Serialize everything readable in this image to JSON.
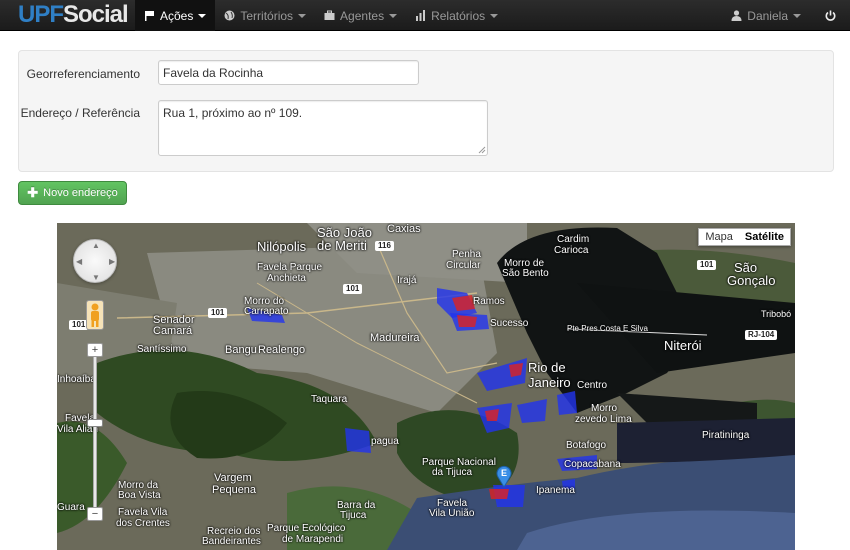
{
  "brand": {
    "part1": "UPF",
    "part2": "Social"
  },
  "nav": {
    "items": [
      {
        "label": "Ações",
        "icon": "flag-icon",
        "active": true
      },
      {
        "label": "Territórios",
        "icon": "globe-icon",
        "active": false
      },
      {
        "label": "Agentes",
        "icon": "briefcase-icon",
        "active": false
      },
      {
        "label": "Relatórios",
        "icon": "bar-chart-icon",
        "active": false
      }
    ],
    "user": "Daniela",
    "power_icon": "power-icon"
  },
  "form": {
    "georef_label": "Georreferenciamento",
    "georef_value": "Favela da Rocinha",
    "address_label": "Endereço / Referência",
    "address_value": "Rua 1, próximo ao nº 109."
  },
  "new_address_button": "Novo endereço",
  "map": {
    "type_map": "Mapa",
    "type_satellite": "Satélite",
    "active_type": "Satélite",
    "marker_letter": "E",
    "labels": {
      "caxias": "Caxias",
      "sao_joao": "São João",
      "de_meriti": "de Meriti",
      "nilopolis": "Nilópolis",
      "favela_parque": "Favela Parque",
      "anchieta": "Anchieta",
      "penha": "Penha",
      "circular": "Circular",
      "cardim": "Cardim",
      "carioca": "Carioca",
      "morro_de": "Morro de",
      "sao_bento": "São Bento",
      "sao": "São",
      "goncalo": "Gonçalo",
      "morro_do": "Morro do",
      "carrapato": "Carrapato",
      "iraja": "Irajá",
      "ramos": "Ramos",
      "sucesso": "Sucesso",
      "bridge": "Pte Pres Costa E Silva",
      "tribobo": "Tribobó",
      "senador": "Senador",
      "camara": "Camará",
      "santissimo": "Santíssimo",
      "bangu": "Bangu",
      "realengo": "Realengo",
      "madureira": "Madureira",
      "niteroi": "Niterói",
      "rio_de": "Rio de",
      "janeiro": "Janeiro",
      "centro": "Centro",
      "inhoaiba": "Inhoaíba",
      "taquara": "Taquara",
      "morro_zevedo": "Morro",
      "azevedo_lima": "zevedo Lima",
      "favela": "Favela",
      "vila_alianca": "Vila Alian",
      "jacarepagua": "pagua",
      "piratininga": "Piratininga",
      "botafogo": "Botafogo",
      "parque_nacional": "Parque Nacional",
      "da_tijuca": "da Tijuca",
      "copacabana": "Copacabana",
      "vargem": "Vargem",
      "pequena": "Pequena",
      "morro_da": "Morro da",
      "boa_vista": "Boa Vista",
      "ipanema": "Ipanema",
      "barra_da": "Barra da",
      "tijuca": "Tijuca",
      "favela2": "Favela",
      "vila_uniao": "Vila União",
      "guara": "Guara",
      "favela_vila": "Favela Vila",
      "dos_crentes": "dos Crentes",
      "recreio_dos": "Recreio dos",
      "bandeirantes": "Bandeirantes",
      "parque_eco": "Parque Ecológico",
      "de_marapendi": "de Marapendi"
    },
    "shields": [
      "116",
      "101",
      "101",
      "101",
      "RJ-104",
      "101"
    ]
  }
}
